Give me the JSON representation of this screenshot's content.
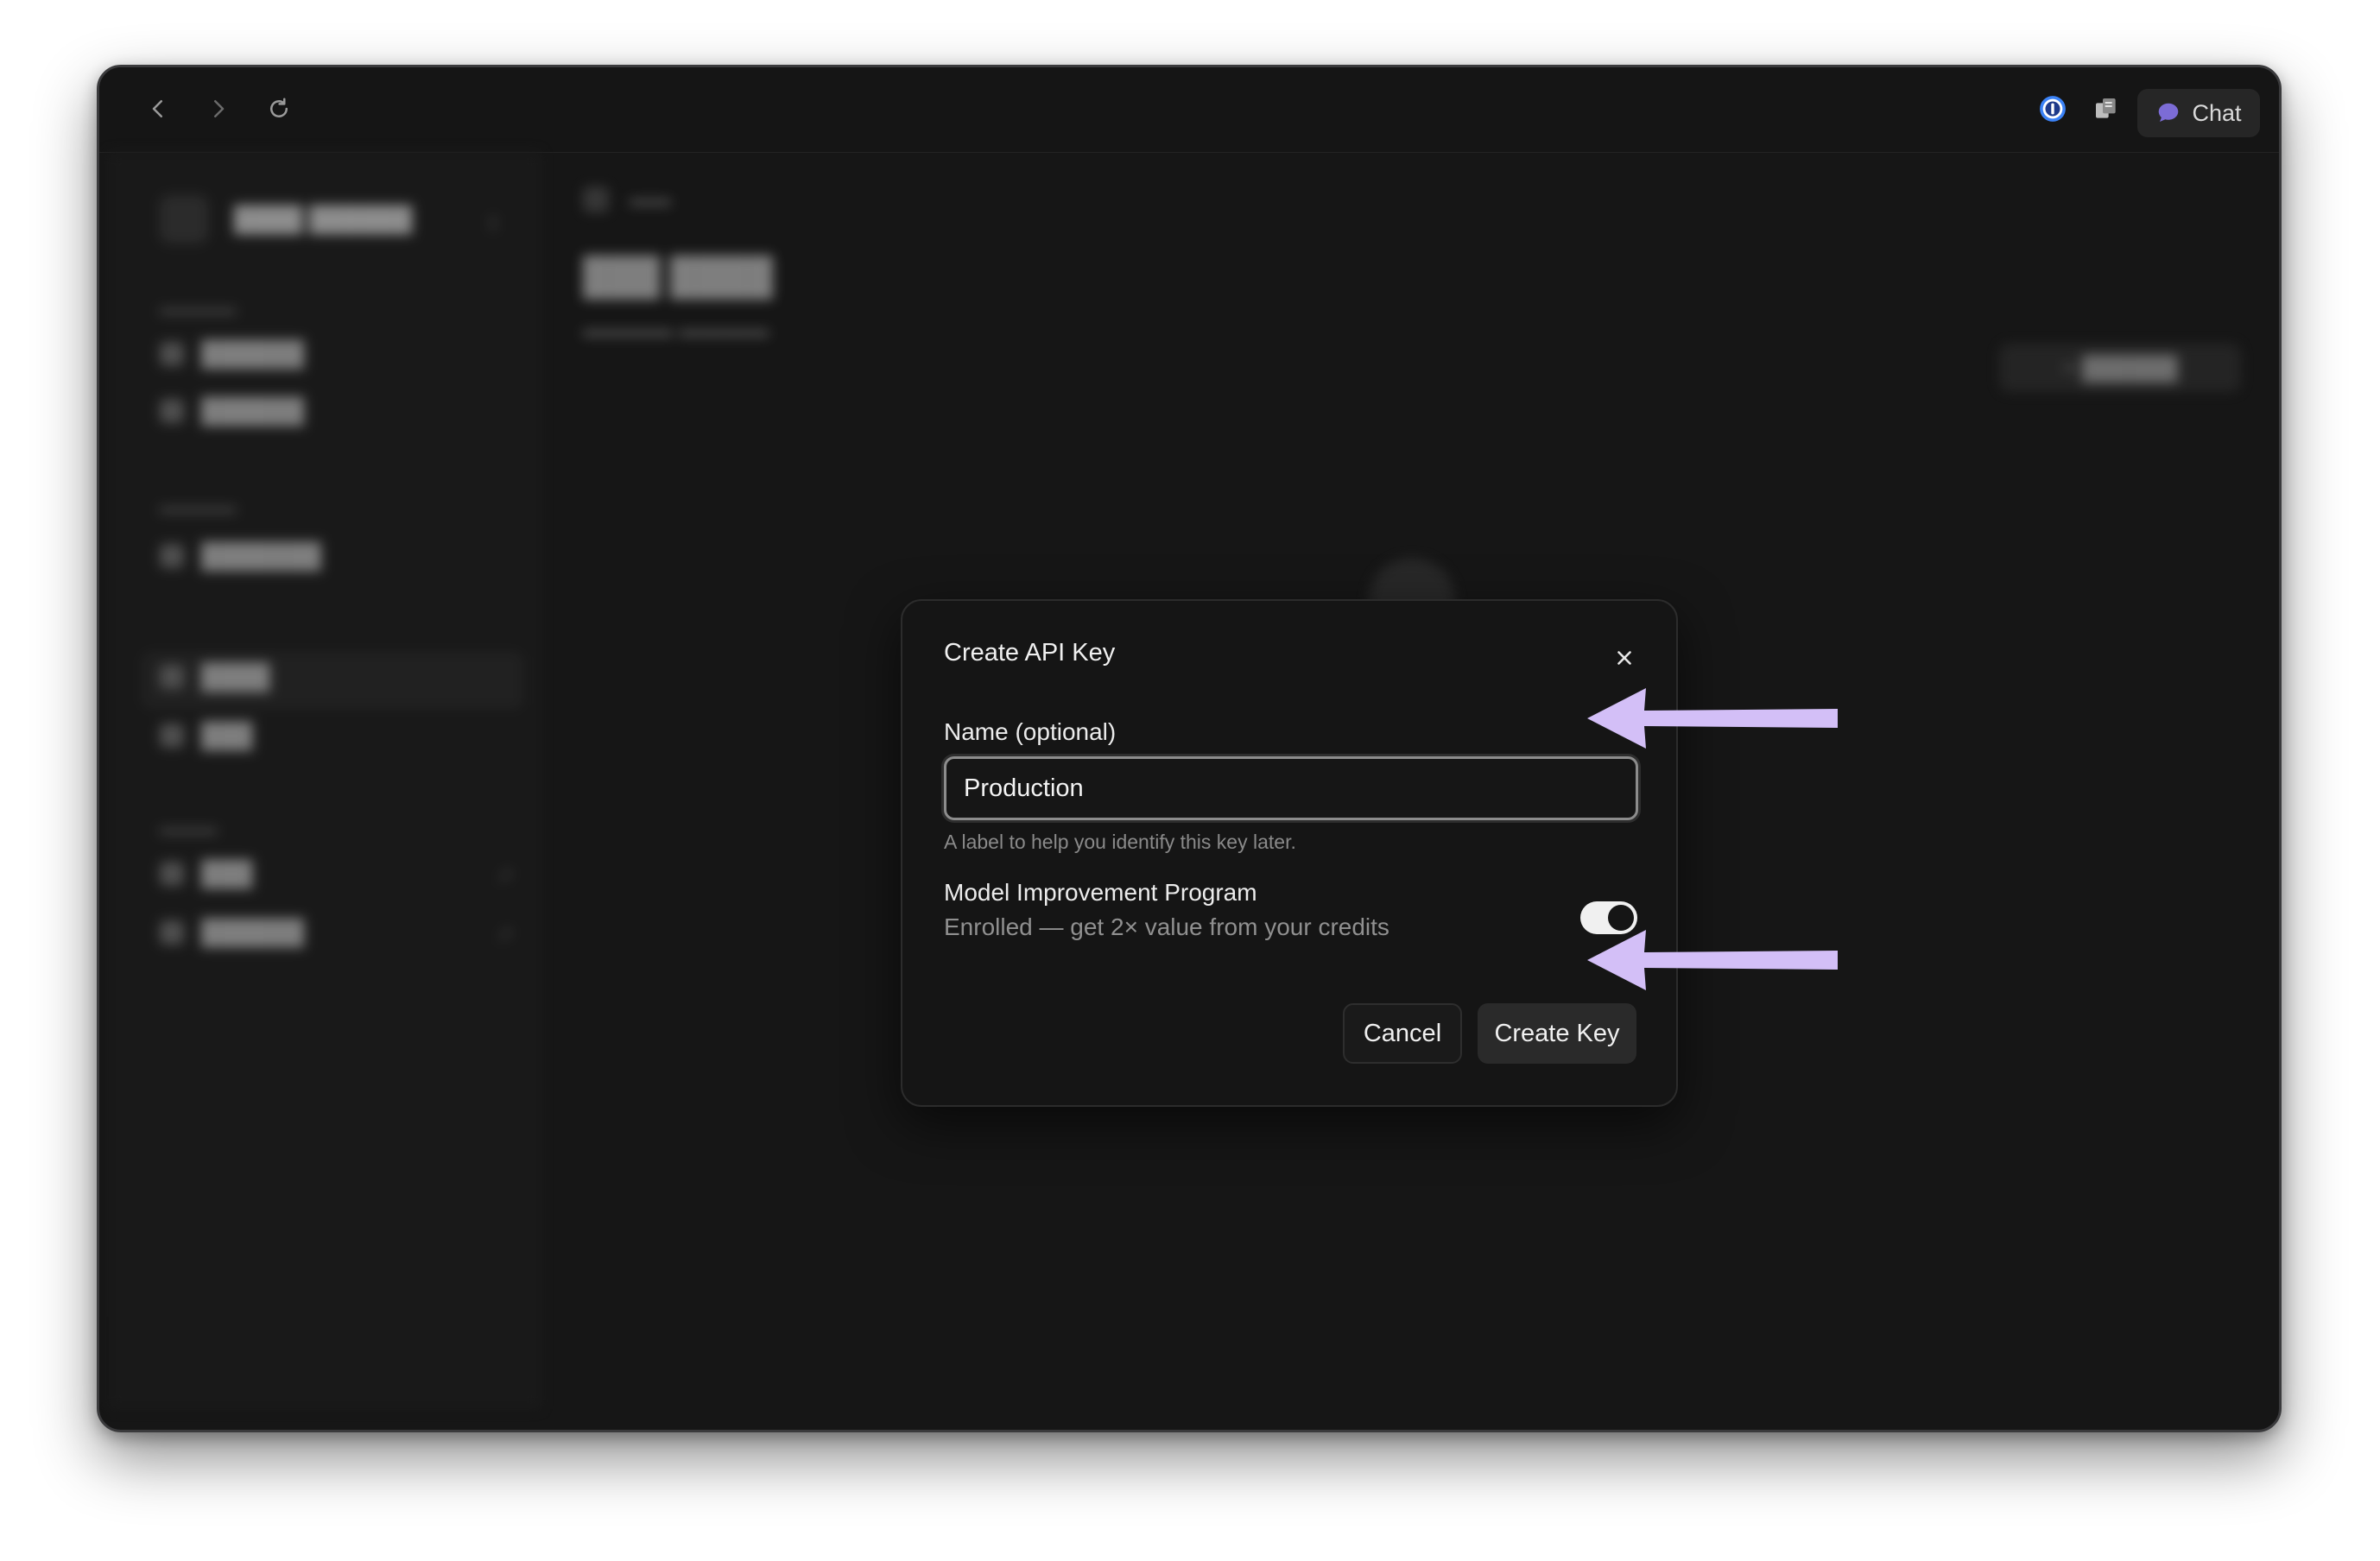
{
  "titlebar": {
    "chat_label": "Chat"
  },
  "icons": {
    "back": "chevron-left-icon",
    "forward": "chevron-right-icon",
    "reload": "reload-icon",
    "password_manager": "password-manager-icon",
    "extension": "extension-icon",
    "chat": "chat-bubble-icon",
    "close": "close-icon"
  },
  "colors": {
    "window_bg": "#161616",
    "accent_arrow": "#d3bff7",
    "password_icon_blue": "#3b82f6",
    "chat_icon": "#7c6cd6"
  },
  "dialog": {
    "title": "Create API Key",
    "name_label": "Name (optional)",
    "name_value": "Production",
    "help_text": "A label to help you identify this key later.",
    "mip_title": "Model Improvement Program",
    "mip_subtitle": "Enrolled — get 2× value from your credits",
    "mip_enabled": true,
    "cancel_label": "Cancel",
    "create_label": "Create Key"
  }
}
